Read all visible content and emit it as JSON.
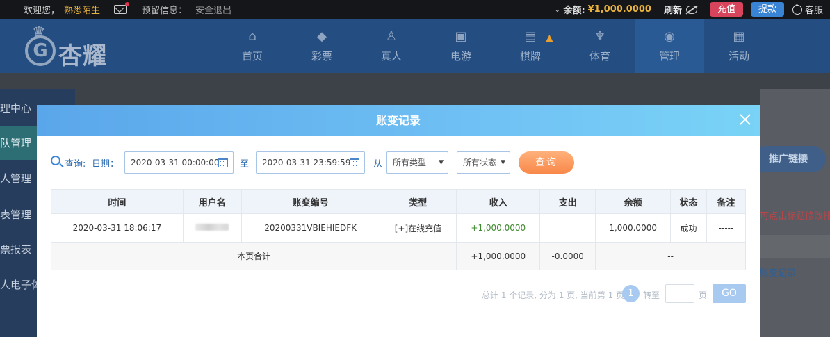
{
  "topbar": {
    "welcome": "欢迎您，",
    "username": "熟悉陌生",
    "reserved_label": "预留信息：",
    "logout": "安全退出",
    "balance_label": "余额:",
    "balance_value": "¥1,000.0000",
    "refresh": "刷新",
    "recharge": "充值",
    "withdraw": "提款",
    "customer_service": "客服"
  },
  "logo": {
    "text": "杏耀"
  },
  "nav": {
    "items": [
      {
        "label": "首页",
        "icon": "home-icon",
        "glyph": "⌂"
      },
      {
        "label": "彩票",
        "icon": "ticket-icon",
        "glyph": "◆"
      },
      {
        "label": "真人",
        "icon": "person-icon",
        "glyph": "♙"
      },
      {
        "label": "电游",
        "icon": "slot-machine-icon",
        "glyph": "▣"
      },
      {
        "label": "棋牌",
        "icon": "cards-icon",
        "glyph": "▤"
      },
      {
        "label": "体育",
        "icon": "trophy-icon",
        "glyph": "♆"
      },
      {
        "label": "管理",
        "icon": "users-icon",
        "glyph": "◉"
      },
      {
        "label": "活动",
        "icon": "gift-icon",
        "glyph": "▦"
      }
    ]
  },
  "sidebar": {
    "items": [
      {
        "label": "理中心"
      },
      {
        "label": "队管理"
      },
      {
        "label": "人管理"
      },
      {
        "label": "表管理"
      },
      {
        "label": "票报表"
      },
      {
        "label": "人电子体"
      }
    ]
  },
  "right_panel": {
    "promo": "推广链接",
    "hint": "可点击标题修改排序",
    "link": "账变记录"
  },
  "modal": {
    "title": "账变记录",
    "query": {
      "label": "查询:",
      "date_label": "日期：",
      "start": "2020-03-31 00:00:00",
      "to": "至",
      "end": "2020-03-31 23:59:59",
      "from": "从",
      "type": "所有类型",
      "status": "所有状态",
      "button": "查询"
    },
    "table": {
      "headers": [
        "时间",
        "用户名",
        "账变编号",
        "类型",
        "收入",
        "支出",
        "余额",
        "状态",
        "备注"
      ],
      "row": {
        "time": "2020-03-31 18:06:17",
        "id": "20200331VBIEHIEDFK",
        "type": "[+]在线充值",
        "income": "+1,000.0000",
        "expense": "",
        "balance": "1,000.0000",
        "status": "成功",
        "note": "-----"
      },
      "total": {
        "label": "本页合计",
        "income": "+1,000.0000",
        "expense": "-0.0000",
        "rest": "--"
      }
    },
    "pager": {
      "info": "总计 1 个记录, 分为 1 页, 当前第 1 页",
      "current": "1",
      "goto": "转至",
      "unit": "页",
      "go": "GO"
    }
  },
  "colors": {
    "accent_blue": "#3a86d4",
    "query_orange": "#f8884a",
    "income_green": "#3e8a2e",
    "balance_gold": "#e8b23f"
  }
}
